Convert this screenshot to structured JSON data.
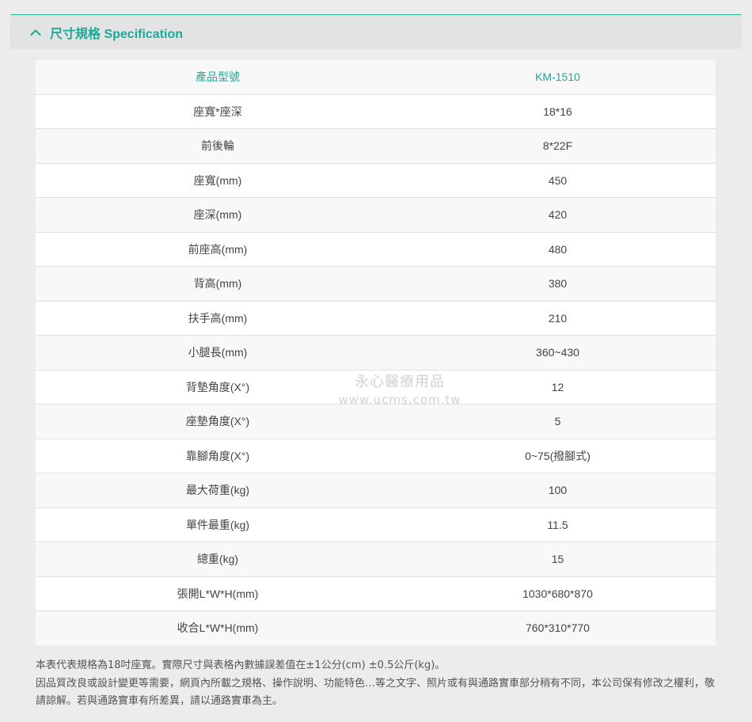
{
  "section": {
    "title": "尺寸規格 Specification",
    "icon": "chevron-up-icon"
  },
  "table": {
    "header": {
      "label": "產品型號",
      "value": "KM-1510"
    },
    "rows": [
      {
        "label": "座寬*座深",
        "value": "18*16"
      },
      {
        "label": "前後輪",
        "value": "8*22F"
      },
      {
        "label": "座寬(mm)",
        "value": "450"
      },
      {
        "label": "座深(mm)",
        "value": "420"
      },
      {
        "label": "前座高(mm)",
        "value": "480"
      },
      {
        "label": "背高(mm)",
        "value": "380"
      },
      {
        "label": "扶手高(mm)",
        "value": "210"
      },
      {
        "label": "小腿長(mm)",
        "value": "360~430"
      },
      {
        "label": "背墊角度(X°)",
        "value": "12"
      },
      {
        "label": "座墊角度(X°)",
        "value": "5"
      },
      {
        "label": "靠腳角度(X°)",
        "value": "0~75(撥腳式)"
      },
      {
        "label": "最大荷重(kg)",
        "value": "100"
      },
      {
        "label": "單件最重(kg)",
        "value": "11.5"
      },
      {
        "label": "總重(kg)",
        "value": "15"
      },
      {
        "label": "張開L*W*H(mm)",
        "value": "1030*680*870"
      },
      {
        "label": "收合L*W*H(mm)",
        "value": "760*310*770"
      }
    ]
  },
  "watermark": {
    "line1": "永心醫療用品",
    "line2": "www.ucms.com.tw"
  },
  "notes": {
    "line1": "本表代表規格為18吋座寬。實際尺寸與表格內數據誤差值在±1公分(cm) ±0.5公斤(kg)。",
    "line2": "因品質改良或設計變更等需要，網頁內所載之規格、操作說明、功能特色…等之文字、照片或有與通路實車部分稍有不同，本公司保有修改之權利，敬請諒解。若與通路實車有所差異，請以通路實車為主。"
  },
  "colors": {
    "accent": "#1ba99a",
    "text": "#444444",
    "background": "#ececec"
  }
}
